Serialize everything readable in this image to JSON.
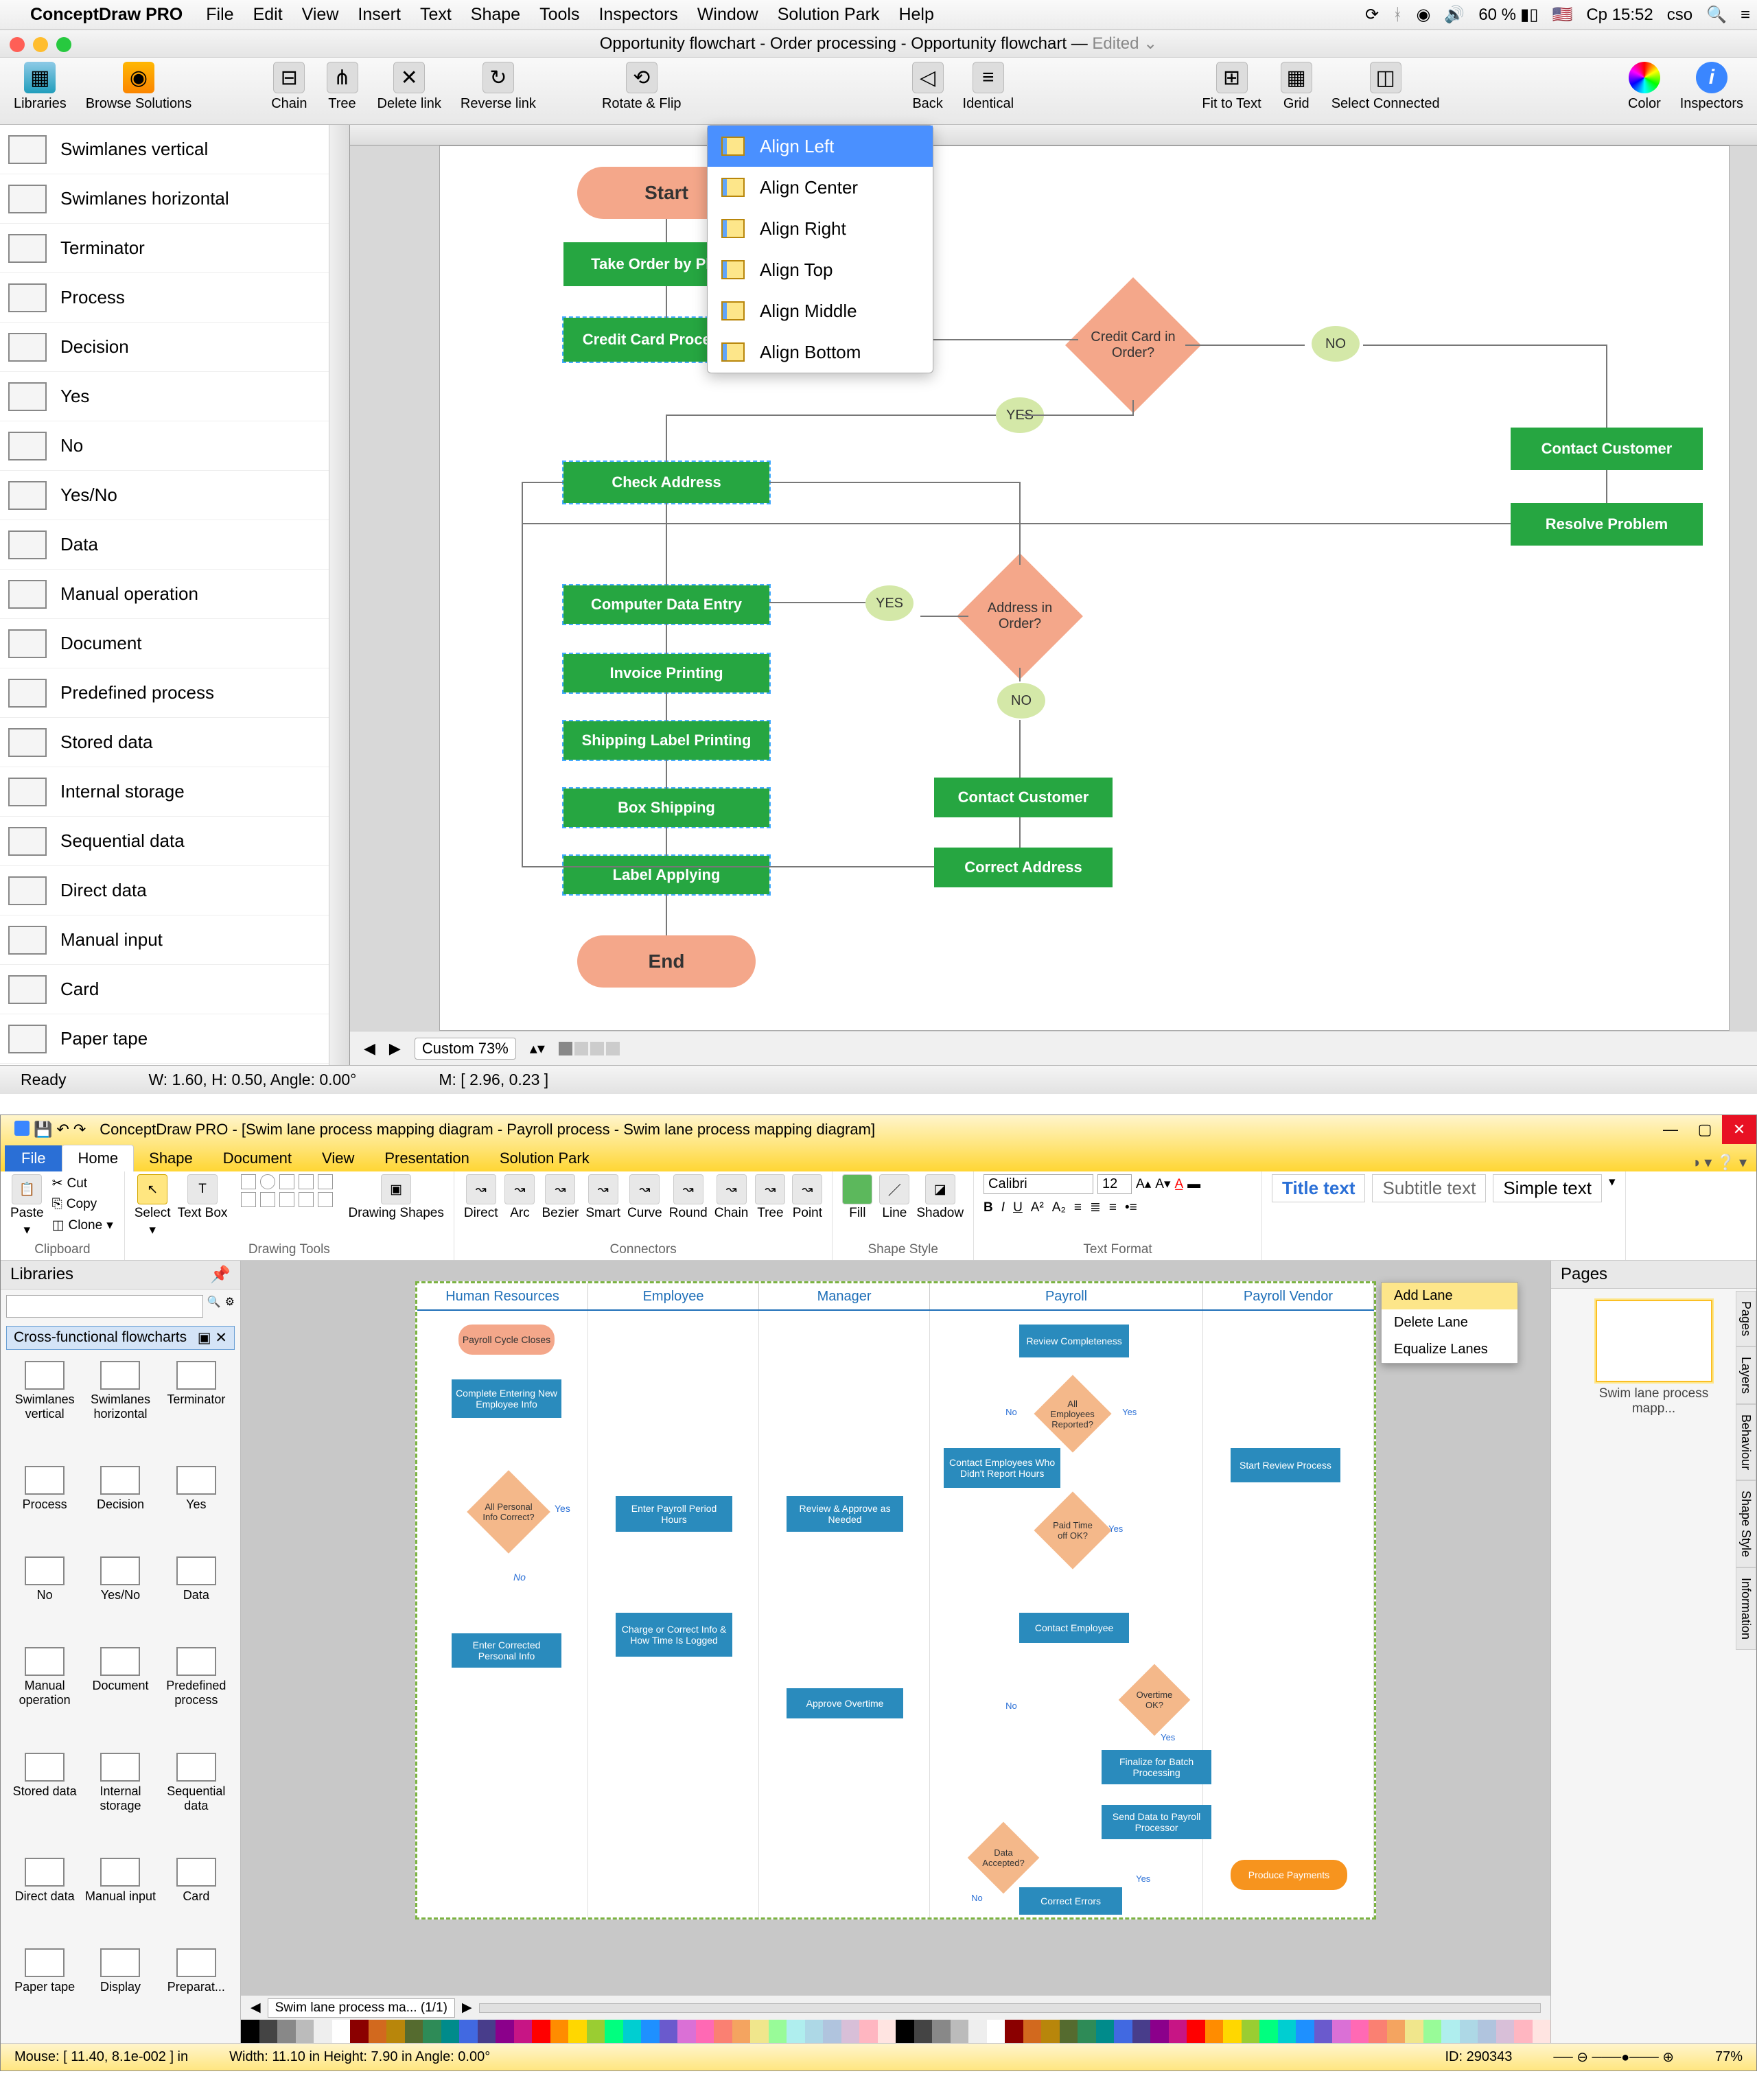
{
  "mac": {
    "menubar": {
      "app_name": "ConceptDraw PRO",
      "items": [
        "File",
        "Edit",
        "View",
        "Insert",
        "Text",
        "Shape",
        "Tools",
        "Inspectors",
        "Window",
        "Solution Park",
        "Help"
      ],
      "battery": "60 %",
      "clock": "Cp 15:52",
      "user": "cso"
    },
    "title": "Opportunity flowchart - Order processing - Opportunity flowchart —",
    "title_suffix": "Edited",
    "toolbar": {
      "libraries": "Libraries",
      "browse": "Browse Solutions",
      "chain": "Chain",
      "tree": "Tree",
      "delete_link": "Delete link",
      "reverse_link": "Reverse link",
      "rotate_flip": "Rotate & Flip",
      "back": "Back",
      "identical": "Identical",
      "fit": "Fit to Text",
      "grid": "Grid",
      "select_connected": "Select Connected",
      "color": "Color",
      "inspectors": "Inspectors"
    },
    "align_menu": [
      "Align Left",
      "Align Center",
      "Align Right",
      "Align Top",
      "Align Middle",
      "Align Bottom"
    ],
    "shapes_panel": [
      "Swimlanes vertical",
      "Swimlanes horizontal",
      "Terminator",
      "Process",
      "Decision",
      "Yes",
      "No",
      "Yes/No",
      "Data",
      "Manual operation",
      "Document",
      "Predefined process",
      "Stored data",
      "Internal storage",
      "Sequential data",
      "Direct data",
      "Manual input",
      "Card",
      "Paper tape"
    ],
    "flowchart": {
      "start": "Start",
      "end": "End",
      "take_order": "Take Order by Phone",
      "cc_proc": "Credit Card Processing",
      "check_addr": "Check Address",
      "cde": "Computer Data Entry",
      "invoice": "Invoice Printing",
      "ship_label": "Shipping Label Printing",
      "box_ship": "Box Shipping",
      "label_app": "Label Applying",
      "cc_order": "Credit Card in Order?",
      "addr_order": "Address in Order?",
      "contact": "Contact Customer",
      "correct_addr": "Correct Address",
      "contact2": "Contact Customer",
      "resolve": "Resolve Problem",
      "yes": "YES",
      "no": "NO"
    },
    "zoom_label": "Custom 73%",
    "status": {
      "ready": "Ready",
      "wh": "W: 1.60,  H: 0.50,  Angle: 0.00°",
      "mouse": "M: [ 2.96, 0.23 ]"
    }
  },
  "win": {
    "title": "ConceptDraw PRO - [Swim lane process mapping diagram - Payroll process - Swim lane process mapping diagram]",
    "file": "File",
    "tabs": [
      "Home",
      "Shape",
      "Document",
      "View",
      "Presentation",
      "Solution Park"
    ],
    "ribbon": {
      "clipboard": {
        "label": "Clipboard",
        "paste": "Paste",
        "cut": "Cut",
        "copy": "Copy",
        "clone": "Clone"
      },
      "select": "Select",
      "textbox": "Text Box",
      "drawing": {
        "label": "Drawing Tools",
        "shapes": "Drawing Shapes"
      },
      "connectors": {
        "label": "Connectors",
        "items": [
          "Direct",
          "Arc",
          "Bezier",
          "Smart",
          "Curve",
          "Round",
          "Chain",
          "Tree",
          "Point"
        ]
      },
      "shape_style": {
        "label": "Shape Style",
        "fill": "Fill",
        "line": "Line",
        "shadow": "Shadow"
      },
      "text_format": {
        "label": "Text Format",
        "font": "Calibri",
        "size": "12"
      },
      "titles": {
        "title": "Title text",
        "subtitle": "Subtitle text",
        "simple": "Simple text"
      }
    },
    "libraries": {
      "title": "Libraries",
      "category": "Cross-functional flowcharts",
      "items": [
        "Swimlanes vertical",
        "Swimlanes horizontal",
        "Terminator",
        "Process",
        "Decision",
        "Yes",
        "No",
        "Yes/No",
        "Data",
        "Manual operation",
        "Document",
        "Predefined process",
        "Stored data",
        "Internal storage",
        "Sequential data",
        "Direct data",
        "Manual input",
        "Card",
        "Paper tape",
        "Display",
        "Preparat..."
      ]
    },
    "lanes": [
      "Human Resources",
      "Employee",
      "Manager",
      "Payroll",
      "Payroll Vendor"
    ],
    "payroll": {
      "cycle_closes": "Payroll Cycle Closes",
      "complete_entering": "Complete Entering New Employee Info",
      "all_personal": "All Personal Info Correct?",
      "enter_corrected": "Enter Corrected Personal Info",
      "enter_payroll": "Enter Payroll Period Hours",
      "review_approve": "Review & Approve as Needed",
      "charge_correct": "Charge or Correct Info & How Time Is Logged",
      "approve_overtime": "Approve Overtime",
      "review_complete": "Review Completeness",
      "all_emp": "All Employees Reported?",
      "contact_emp_didnt": "Contact Employees Who Didn't Report Hours",
      "paid_time": "Paid Time off OK?",
      "contact_emp": "Contact Employee",
      "overtime_ok": "Overtime OK?",
      "finalize": "Finalize for Batch Processing",
      "send_data": "Send Data to Payroll Processor",
      "data_accepted": "Data Accepted?",
      "correct_errors": "Correct Errors",
      "start_review": "Start Review Process",
      "produce": "Produce Payments",
      "yes": "Yes",
      "no": "No"
    },
    "context_menu": [
      "Add Lane",
      "Delete Lane",
      "Equalize Lanes"
    ],
    "pages": {
      "title": "Pages",
      "thumb": "Swim lane process mapp..."
    },
    "side_tabs": [
      "Pages",
      "Layers",
      "Behaviour",
      "Shape Style",
      "Information"
    ],
    "doc_tab": "Swim lane process ma... (1/1)",
    "status": {
      "mouse": "Mouse: [ 11.40, 8.1e-002 ] in",
      "dims": "Width: 11.10 in   Height: 7.90 in   Angle: 0.00°",
      "id": "ID: 290343",
      "zoom": "77%"
    }
  }
}
